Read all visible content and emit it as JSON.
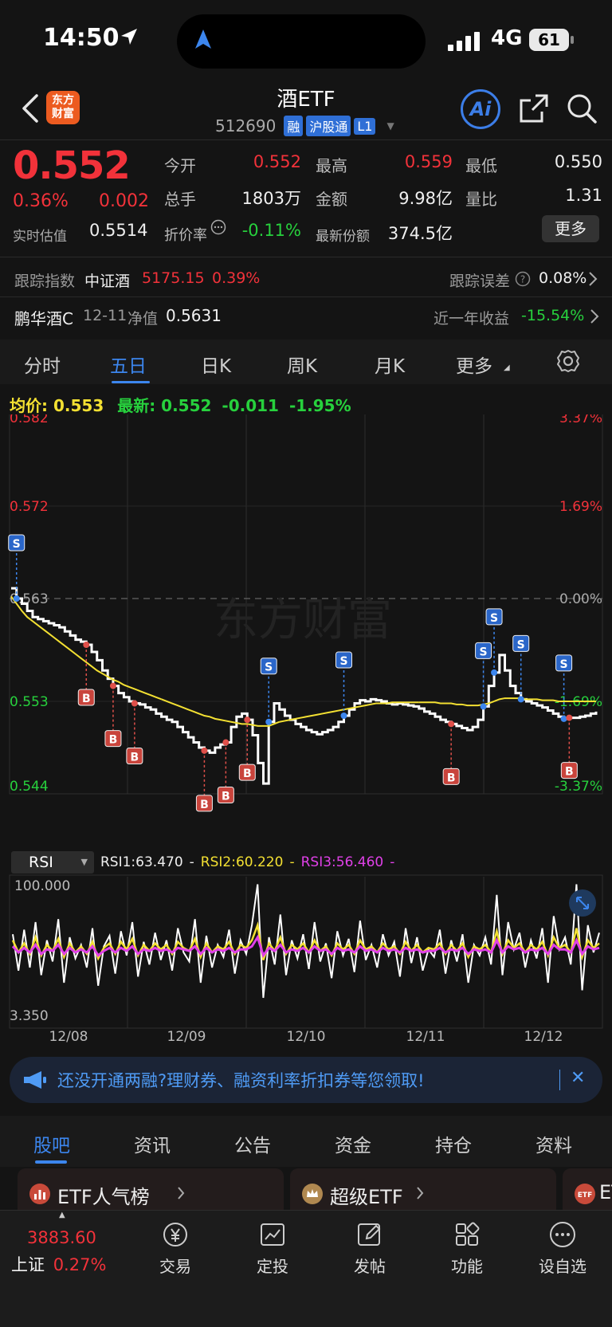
{
  "status_bar": {
    "time": "14:50",
    "network": "4G",
    "battery": "61"
  },
  "header": {
    "logo_line1": "东方",
    "logo_line2": "财富",
    "title": "酒ETF",
    "code": "512690",
    "tags": [
      "融",
      "沪股通",
      "L1"
    ],
    "ai_label": "Ai"
  },
  "quote": {
    "price": "0.552",
    "change_pct": "0.36%",
    "change": "0.002",
    "iopv_label": "实时估值",
    "iopv": "0.5514",
    "fields": [
      {
        "label": "今开",
        "value": "0.552",
        "color": "red"
      },
      {
        "label": "最高",
        "value": "0.559",
        "color": "red"
      },
      {
        "label": "最低",
        "value": "0.550",
        "color": "white"
      },
      {
        "label": "总手",
        "value": "1803万",
        "color": "white"
      },
      {
        "label": "金额",
        "value": "9.98亿",
        "color": "white"
      },
      {
        "label": "量比",
        "value": "1.31",
        "color": "white"
      },
      {
        "label": "折价率",
        "value": "-0.11%",
        "color": "green"
      },
      {
        "label": "最新份额",
        "value": "374.5亿",
        "color": "white"
      }
    ],
    "more_label": "更多"
  },
  "tracking": {
    "label": "跟踪指数",
    "index_name": "中证酒",
    "index_value": "5175.15",
    "index_pct": "0.39%",
    "error_label": "跟踪误差",
    "error_value": "0.08%"
  },
  "linked_fund": {
    "name": "鹏华酒C",
    "date": "12-11",
    "nav_label": "净值",
    "nav": "0.5631",
    "return_label": "近一年收益",
    "return_value": "-15.54%"
  },
  "period_tabs": [
    "分时",
    "五日",
    "日K",
    "周K",
    "月K",
    "更多"
  ],
  "active_period": "五日",
  "chart_summary": {
    "avg_label": "均价:",
    "avg_value": "0.553",
    "latest_label": "最新:",
    "latest_value": "0.552",
    "latest_change": "-0.011",
    "latest_pct": "-1.95%"
  },
  "chart_data": {
    "type": "line",
    "title": "",
    "y_left_ticks": [
      "0.582",
      "0.572",
      "0.563",
      "0.553",
      "0.544"
    ],
    "y_right_ticks": [
      "3.37%",
      "1.69%",
      "0.00%",
      "-1.69%",
      "-3.37%"
    ],
    "ylim": [
      0.544,
      0.582
    ],
    "prev_close": 0.563,
    "x_ticks": [
      "12/08",
      "12/09",
      "12/10",
      "12/11",
      "12/12"
    ],
    "series": [
      {
        "color": "#ffffff",
        "values": [
          0.564,
          0.563,
          0.5625,
          0.5618,
          0.5612,
          0.561,
          0.5608,
          0.5606,
          0.5604,
          0.5602,
          0.5598,
          0.5594,
          0.559,
          0.5588,
          0.5585,
          0.5578,
          0.557,
          0.556,
          0.5552,
          0.5545,
          0.5538,
          0.5534,
          0.553,
          0.5528,
          0.5527,
          0.5524,
          0.5522,
          0.5518,
          0.5515,
          0.5512,
          0.551,
          0.5505,
          0.55,
          0.5495,
          0.549,
          0.5485,
          0.5482,
          0.548,
          0.5485,
          0.5488,
          0.549,
          0.5505,
          0.5515,
          0.5518,
          0.5512,
          0.5497,
          0.547,
          0.545,
          0.551,
          0.5528,
          0.5522,
          0.5516,
          0.5512,
          0.5508,
          0.5505,
          0.5502,
          0.55,
          0.5498,
          0.55,
          0.5502,
          0.5505,
          0.551,
          0.5516,
          0.5522,
          0.5528,
          0.5531,
          0.553,
          0.5532,
          0.5531,
          0.553,
          0.5528,
          0.5527,
          0.5528,
          0.5527,
          0.5526,
          0.5525,
          0.5523,
          0.552,
          0.5518,
          0.5515,
          0.5512,
          0.551,
          0.5508,
          0.5506,
          0.5504,
          0.5502,
          0.5505,
          0.5512,
          0.5525,
          0.5545,
          0.5558,
          0.5575,
          0.556,
          0.5545,
          0.5538,
          0.5532,
          0.553,
          0.5528,
          0.5526,
          0.5524,
          0.5521,
          0.5518,
          0.5515,
          0.5513,
          0.5514,
          0.5514,
          0.5515,
          0.5516,
          0.5518,
          0.552
        ]
      },
      {
        "color": "#f3e032",
        "values": [
          0.5632,
          0.5625,
          0.5618,
          0.5612,
          0.5608,
          0.5604,
          0.56,
          0.5596,
          0.5592,
          0.5588,
          0.5584,
          0.558,
          0.5576,
          0.5572,
          0.5568,
          0.5564,
          0.556,
          0.5557,
          0.5554,
          0.5551,
          0.5549,
          0.5546,
          0.5544,
          0.5542,
          0.554,
          0.5538,
          0.5536,
          0.5534,
          0.5532,
          0.553,
          0.5528,
          0.5526,
          0.5524,
          0.5522,
          0.552,
          0.5518,
          0.5516,
          0.5515,
          0.5513,
          0.5512,
          0.5511,
          0.551,
          0.5509,
          0.5508,
          0.5508,
          0.5507,
          0.5506,
          0.5506,
          0.5506,
          0.5508,
          0.551,
          0.5511,
          0.5512,
          0.5513,
          0.5514,
          0.5515,
          0.5516,
          0.5517,
          0.5518,
          0.5519,
          0.552,
          0.5521,
          0.5522,
          0.5523,
          0.5524,
          0.5525,
          0.5526,
          0.5527,
          0.5528,
          0.5528,
          0.5528,
          0.5529,
          0.5529,
          0.5529,
          0.5529,
          0.5529,
          0.5529,
          0.5529,
          0.5529,
          0.5529,
          0.5528,
          0.5528,
          0.5528,
          0.5527,
          0.5527,
          0.5526,
          0.5526,
          0.5526,
          0.5527,
          0.5528,
          0.553,
          0.5532,
          0.5533,
          0.5533,
          0.5533,
          0.5533,
          0.5532,
          0.5532,
          0.5532,
          0.5531,
          0.5531,
          0.5531,
          0.553,
          0.553,
          0.553,
          0.553,
          0.553,
          0.553,
          0.553,
          0.553
        ]
      }
    ],
    "markers": [
      {
        "type": "S",
        "index": 1
      },
      {
        "type": "B",
        "index": 14
      },
      {
        "type": "B",
        "index": 19
      },
      {
        "type": "B",
        "index": 23
      },
      {
        "type": "B",
        "index": 36
      },
      {
        "type": "B",
        "index": 40
      },
      {
        "type": "B",
        "index": 44
      },
      {
        "type": "S",
        "index": 48
      },
      {
        "type": "S",
        "index": 62
      },
      {
        "type": "B",
        "index": 82
      },
      {
        "type": "S",
        "index": 88
      },
      {
        "type": "S",
        "index": 90
      },
      {
        "type": "S",
        "index": 95
      },
      {
        "type": "S",
        "index": 103
      },
      {
        "type": "B",
        "index": 104
      }
    ],
    "watermark": "东方财富"
  },
  "rsi": {
    "selector": "RSI",
    "rsi1": "RSI1:63.470",
    "rsi2": "RSI2:60.220",
    "rsi3": "RSI3:56.460",
    "dash": "-",
    "top_label": "100.000",
    "bottom_label": "3.350",
    "rsi1_values": [
      62,
      38,
      65,
      40,
      70,
      35,
      58,
      44,
      72,
      30,
      60,
      46,
      55,
      40,
      66,
      28,
      54,
      61,
      36,
      64,
      48,
      70,
      34,
      57,
      42,
      63,
      45,
      58,
      38,
      66,
      50,
      44,
      72,
      30,
      61,
      40,
      55,
      47,
      65,
      36,
      58,
      49,
      68,
      95,
      20,
      60,
      42,
      75,
      35,
      58,
      46,
      62,
      39,
      70,
      44,
      56,
      33,
      64,
      48,
      59,
      37,
      71,
      45,
      55,
      40,
      62,
      48,
      57,
      34,
      66,
      43,
      60,
      38,
      52,
      47,
      65,
      36,
      58,
      44,
      62,
      30,
      55,
      48,
      60,
      42,
      88,
      35,
      70,
      52,
      63,
      40,
      58,
      46,
      66,
      30,
      74,
      52,
      60,
      42,
      95,
      25,
      68,
      50,
      63
    ],
    "rsi2_values": [
      58,
      50,
      56,
      49,
      60,
      48,
      55,
      51,
      59,
      47,
      56,
      50,
      54,
      49,
      57,
      46,
      53,
      56,
      49,
      57,
      52,
      59,
      48,
      55,
      51,
      56,
      52,
      55,
      49,
      57,
      53,
      51,
      59,
      47,
      56,
      50,
      54,
      52,
      57,
      49,
      55,
      53,
      58,
      68,
      45,
      56,
      51,
      60,
      49,
      55,
      52,
      56,
      50,
      58,
      51,
      54,
      48,
      56,
      52,
      55,
      49,
      58,
      52,
      54,
      50,
      56,
      52,
      54,
      49,
      57,
      51,
      55,
      50,
      53,
      52,
      56,
      49,
      55,
      51,
      56,
      47,
      54,
      52,
      55,
      50,
      64,
      49,
      58,
      53,
      56,
      50,
      55,
      52,
      57,
      48,
      60,
      53,
      55,
      50,
      66,
      47,
      58,
      53,
      56
    ],
    "rsi3_values": [
      54,
      50,
      53,
      50,
      55,
      49,
      52,
      51,
      55,
      49,
      53,
      50,
      52,
      50,
      54,
      48,
      51,
      53,
      50,
      53,
      51,
      54,
      49,
      52,
      51,
      53,
      51,
      52,
      50,
      53,
      52,
      51,
      54,
      49,
      53,
      50,
      52,
      51,
      53,
      50,
      52,
      52,
      54,
      60,
      48,
      53,
      51,
      55,
      50,
      52,
      51,
      53,
      50,
      54,
      51,
      52,
      49,
      53,
      51,
      52,
      50,
      54,
      51,
      52,
      50,
      53,
      51,
      52,
      50,
      53,
      51,
      52,
      50,
      51,
      51,
      53,
      50,
      52,
      51,
      53,
      49,
      52,
      51,
      52,
      50,
      58,
      50,
      54,
      52,
      53,
      50,
      52,
      51,
      53,
      49,
      55,
      52,
      52,
      50,
      58,
      49,
      54,
      52,
      53
    ]
  },
  "banner": {
    "text": "还没开通两融?理财券、融资利率折扣券等您领取!"
  },
  "content_tabs": [
    "股吧",
    "资讯",
    "公告",
    "资金",
    "持仓",
    "资料"
  ],
  "active_content_tab": "股吧",
  "cards": [
    {
      "label": "ETF人气榜",
      "icon": "chart-badge-icon"
    },
    {
      "label": "超级ETF",
      "icon": "crown-badge-icon"
    },
    {
      "label": "ETF",
      "icon": "etf-badge-icon"
    }
  ],
  "bottom_bar": {
    "index_value": "3883.60",
    "index_name": "上证",
    "index_pct": "0.27%",
    "items": [
      "交易",
      "定投",
      "发帖",
      "功能",
      "设自选"
    ]
  },
  "colors": {
    "up": "#f2323a",
    "down": "#27d13d",
    "accent": "#3c86ee",
    "avg_line": "#f3e032",
    "rsi3": "#e040e8"
  }
}
